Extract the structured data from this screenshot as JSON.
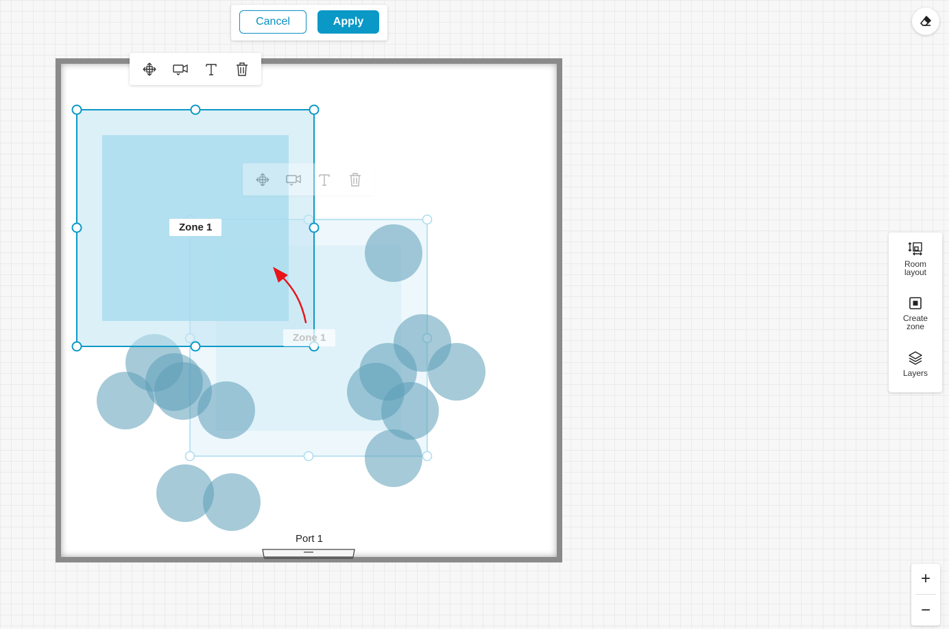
{
  "topbar": {
    "cancel_label": "Cancel",
    "apply_label": "Apply"
  },
  "toolbar_tools": [
    "move-icon",
    "camera-icon",
    "text-icon",
    "trash-icon"
  ],
  "zones": {
    "active": {
      "label": "Zone 1"
    },
    "ghost": {
      "label": "Zone 1"
    }
  },
  "port": {
    "label": "Port 1"
  },
  "right_panel": {
    "room_layout": "Room layout",
    "create_zone": "Create zone",
    "layers": "Layers"
  },
  "zoom": {
    "in": "+",
    "out": "−"
  },
  "colors": {
    "accent": "#0a98c6",
    "zone_fill": "#a6dbee",
    "person_circle": "#5d9fb8",
    "annotation_arrow": "#e8141a",
    "room_wall": "#8a8a8a"
  }
}
